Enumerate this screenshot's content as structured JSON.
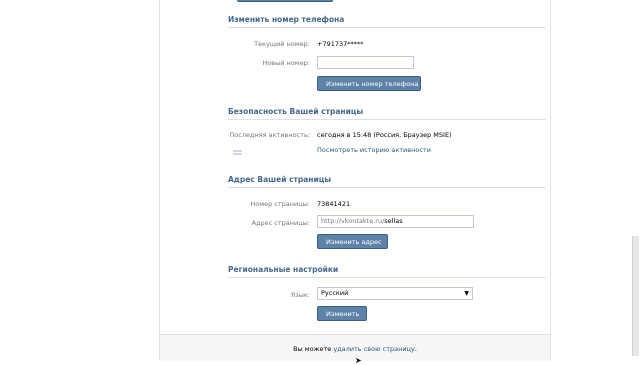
{
  "phone": {
    "title": "Изменить номер телефона",
    "current_label": "Текущий номер:",
    "current_value": "+791737*****",
    "new_label": "Новый номер:",
    "new_value": "",
    "button": "Изменить номер телефона"
  },
  "security": {
    "title": "Безопасность Вашей страницы",
    "last_activity_label": "Последняя активность:",
    "last_activity_value": "сегодня в 15:48 (Россия, Браузер MSIE)",
    "history_link": "Посмотреть историю активности"
  },
  "address": {
    "title": "Адрес Вашей страницы",
    "page_number_label": "Номер страницы:",
    "page_number_value": "73841421",
    "page_address_label": "Адрес страницы:",
    "address_prefix": "http://vkontakte.ru/",
    "address_value": "sellas",
    "button": "Изменить адрес"
  },
  "regional": {
    "title": "Региональные настройки",
    "language_label": "Язык:",
    "language_value": "Русский",
    "button": "Изменить"
  },
  "footer": {
    "text_before": "Вы можете ",
    "delete_link": "удалить свою страницу",
    "text_after": "."
  }
}
